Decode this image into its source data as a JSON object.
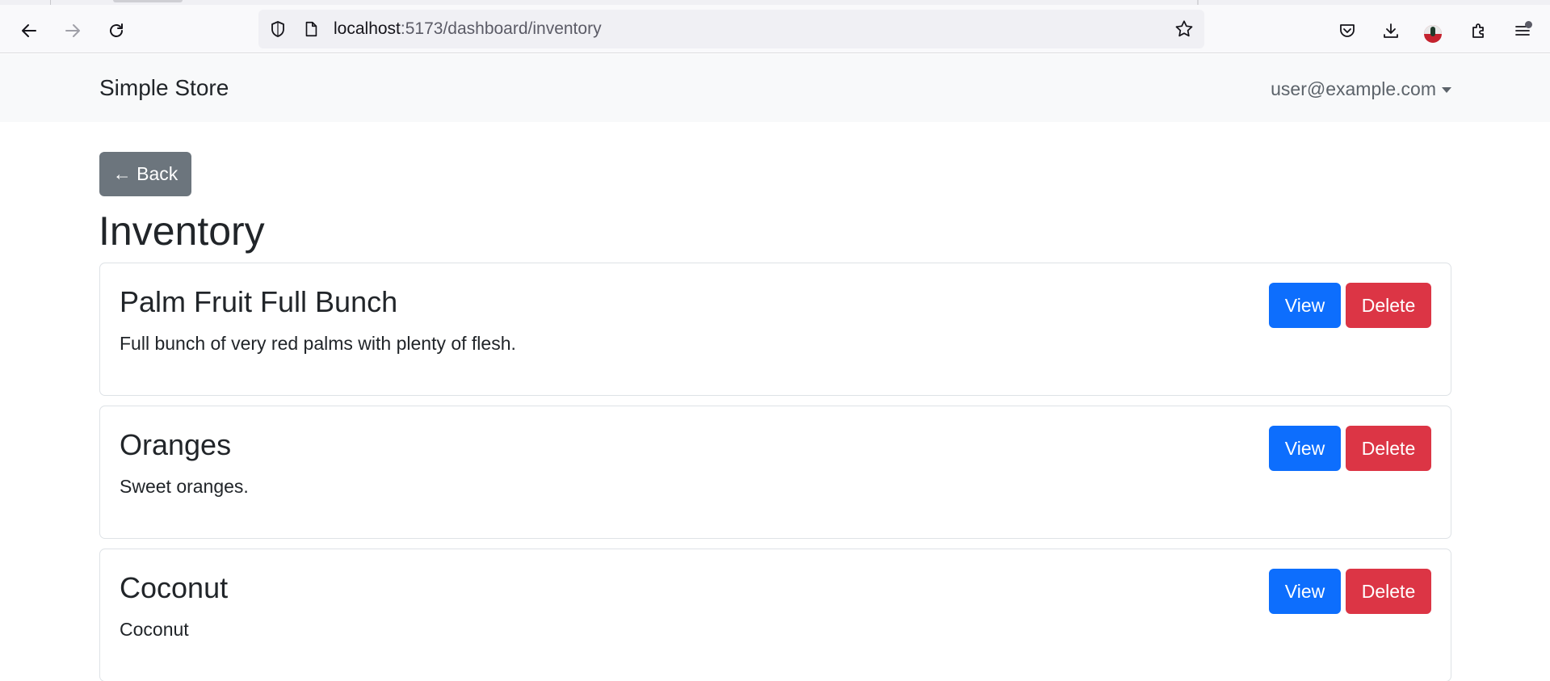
{
  "browser": {
    "url_host": "localhost",
    "url_path": ":5173/dashboard/inventory"
  },
  "navbar": {
    "brand": "Simple Store",
    "user_email": "user@example.com"
  },
  "main": {
    "back_label": "← Back",
    "title": "Inventory"
  },
  "items": [
    {
      "name": "Palm Fruit Full Bunch",
      "description": "Full bunch of very red palms with plenty of flesh.",
      "view_label": "View",
      "delete_label": "Delete"
    },
    {
      "name": "Oranges",
      "description": "Sweet oranges.",
      "view_label": "View",
      "delete_label": "Delete"
    },
    {
      "name": "Coconut",
      "description": "Coconut",
      "view_label": "View",
      "delete_label": "Delete"
    }
  ],
  "colors": {
    "primary": "#0d6efd",
    "danger": "#dc3545",
    "secondary": "#6c757d",
    "navbar_bg": "#f8f9fa"
  }
}
